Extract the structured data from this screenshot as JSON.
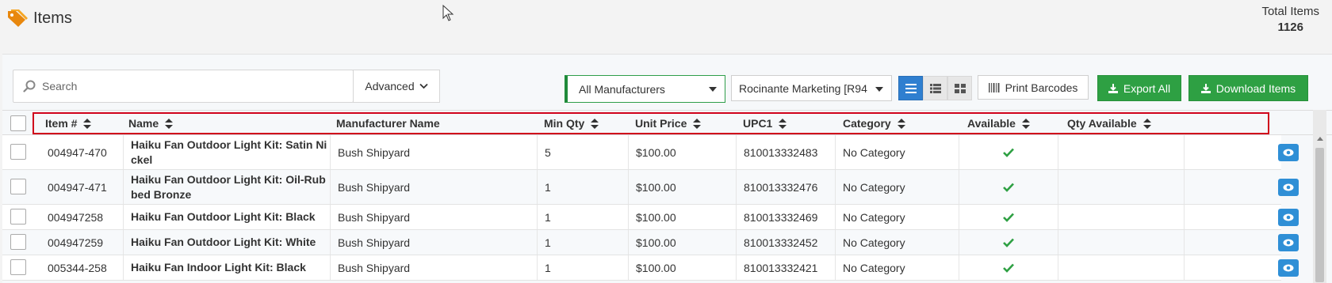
{
  "page": {
    "title": "Items",
    "total_label": "Total Items",
    "total_count": "1126"
  },
  "toolbar": {
    "search_placeholder": "Search",
    "advanced_label": "Advanced",
    "manufacturer_select": "All Manufacturers",
    "vendor_select": "Rocinante Marketing [R94",
    "print_barcodes": "Print Barcodes",
    "export_all": "Export All",
    "download_items": "Download Items"
  },
  "table": {
    "columns": [
      "Item #",
      "Name",
      "Manufacturer Name",
      "Min Qty",
      "Unit Price",
      "UPC1",
      "Category",
      "Available",
      "Qty Available"
    ],
    "rows": [
      {
        "item": "004947-470",
        "name_1": "Haiku Fan Outdoor Light Kit: Satin Ni",
        "name_2": "ckel",
        "manufacturer": "Bush Shipyard",
        "min_qty": "5",
        "unit_price": "$100.00",
        "upc": "810013332483",
        "category": "No Category",
        "available": true,
        "qty_available": ""
      },
      {
        "item": "004947-471",
        "name_1": "Haiku Fan Outdoor Light Kit: Oil-Rub",
        "name_2": "bed Bronze",
        "manufacturer": "Bush Shipyard",
        "min_qty": "1",
        "unit_price": "$100.00",
        "upc": "810013332476",
        "category": "No Category",
        "available": true,
        "qty_available": ""
      },
      {
        "item": "004947258",
        "name_1": "Haiku Fan Outdoor Light Kit: Black",
        "name_2": "",
        "manufacturer": "Bush Shipyard",
        "min_qty": "1",
        "unit_price": "$100.00",
        "upc": "810013332469",
        "category": "No Category",
        "available": true,
        "qty_available": ""
      },
      {
        "item": "004947259",
        "name_1": "Haiku Fan Outdoor Light Kit: White",
        "name_2": "",
        "manufacturer": "Bush Shipyard",
        "min_qty": "1",
        "unit_price": "$100.00",
        "upc": "810013332452",
        "category": "No Category",
        "available": true,
        "qty_available": ""
      },
      {
        "item": "005344-258",
        "name_1": "Haiku Fan Indoor Light Kit: Black",
        "name_2": "",
        "manufacturer": "Bush Shipyard",
        "min_qty": "1",
        "unit_price": "$100.00",
        "upc": "810013332421",
        "category": "No Category",
        "available": true,
        "qty_available": ""
      }
    ]
  },
  "colors": {
    "brand_orange": "#f39c12",
    "green": "#2ea043",
    "blue": "#2f7fd0",
    "highlight_red": "#d0021b"
  },
  "icons": [
    "tag-icon",
    "search-icon",
    "chevron-down-icon",
    "list-view-icon",
    "detail-view-icon",
    "grid-view-icon",
    "barcode-icon",
    "download-icon",
    "sort-icon",
    "check-icon",
    "eye-icon"
  ]
}
